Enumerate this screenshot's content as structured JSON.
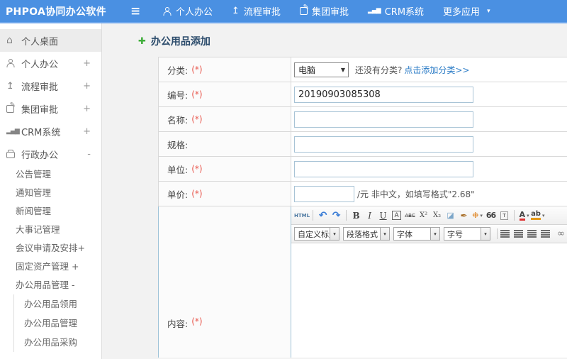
{
  "topbar": {
    "logo": "PHPOA协同办公软件",
    "menu": [
      "个人办公",
      "流程审批",
      "集团审批",
      "CRM系统",
      "更多应用"
    ]
  },
  "icons": {
    "hamburger": "≡",
    "export": "↥",
    "chart": "▂▄▆",
    "home": "⌂",
    "caret": "▾",
    "plus": "✚",
    "select_arrow": "▼",
    "link": "∞"
  },
  "sidebar": {
    "l1": [
      {
        "label": "个人桌面",
        "expand": ""
      },
      {
        "label": "个人办公",
        "expand": "+"
      },
      {
        "label": "流程审批",
        "expand": "+"
      },
      {
        "label": "集团审批",
        "expand": "+"
      },
      {
        "label": "CRM系统",
        "expand": "+"
      },
      {
        "label": "行政办公",
        "expand": "-"
      }
    ],
    "l2": [
      "公告管理",
      "通知管理",
      "新闻管理",
      "大事记管理",
      "会议申请及安排+",
      "固定资产管理 +",
      "办公用品管理 -"
    ],
    "l3": [
      "办公用品领用",
      "办公用品管理",
      "办公用品采购"
    ]
  },
  "form": {
    "title": "办公用品添加",
    "required_mark": "(*)",
    "category": {
      "label": "分类:",
      "value": "电脑",
      "hint": "还没有分类?",
      "link": "点击添加分类>>"
    },
    "code": {
      "label": "编号:",
      "value": "20190903085308"
    },
    "name": {
      "label": "名称:"
    },
    "spec": {
      "label": "规格:"
    },
    "unit": {
      "label": "单位:"
    },
    "price": {
      "label": "单价:",
      "suffix": "/元 非中文，如填写格式\"2.68\""
    },
    "content": {
      "label": "内容:"
    }
  },
  "editor": {
    "buttons": {
      "html": "HTML",
      "undo": "↶",
      "redo": "↷",
      "bold": "B",
      "italic": "I",
      "underline": "U",
      "char_border": "A",
      "strike": "ABC",
      "superscript": "X²",
      "subscript": "X₂",
      "eraser": "◪",
      "format_brush": "✒",
      "auto_typeset": "❉",
      "quote": "66",
      "paste_text": "T",
      "font_color": "A",
      "highlight": "ab"
    },
    "dropdowns": [
      "自定义标题",
      "段落格式",
      "字体",
      "字号"
    ],
    "caret": "▾"
  },
  "colors": {
    "topbar_blue": "#4a90e2",
    "link_blue": "#2a7bc6",
    "required_red": "#e9594f",
    "title_navy": "#2b4b6b",
    "plus_green": "#3fae3a"
  }
}
